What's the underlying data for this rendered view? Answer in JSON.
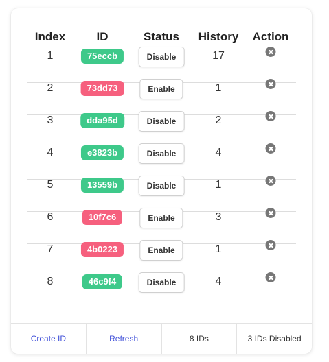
{
  "table": {
    "columns": [
      "Index",
      "ID",
      "Status",
      "History",
      "Action"
    ],
    "rows": [
      {
        "index": "1",
        "id": "75eccb",
        "id_color": "#3ec98a",
        "status_button": "Disable",
        "history": "17"
      },
      {
        "index": "2",
        "id": "73dd73",
        "id_color": "#f6607e",
        "status_button": "Enable",
        "history": "1"
      },
      {
        "index": "3",
        "id": "dda95d",
        "id_color": "#3ec98a",
        "status_button": "Disable",
        "history": "2"
      },
      {
        "index": "4",
        "id": "e3823b",
        "id_color": "#3ec98a",
        "status_button": "Disable",
        "history": "4"
      },
      {
        "index": "5",
        "id": "13559b",
        "id_color": "#3ec98a",
        "status_button": "Disable",
        "history": "1"
      },
      {
        "index": "6",
        "id": "10f7c6",
        "id_color": "#f6607e",
        "status_button": "Enable",
        "history": "3"
      },
      {
        "index": "7",
        "id": "4b0223",
        "id_color": "#f6607e",
        "status_button": "Enable",
        "history": "1"
      },
      {
        "index": "8",
        "id": "46c9f4",
        "id_color": "#3ec98a",
        "status_button": "Disable",
        "history": "4"
      }
    ],
    "action_icon": "remove-circle-icon"
  },
  "footer": {
    "create_label": "Create ID",
    "refresh_label": "Refresh",
    "count_label": "8 IDs",
    "disabled_label": "3 IDs Disabled"
  },
  "colors": {
    "enabled_pill": "#3ec98a",
    "disabled_pill": "#f6607e",
    "link": "#3f4fd8"
  }
}
